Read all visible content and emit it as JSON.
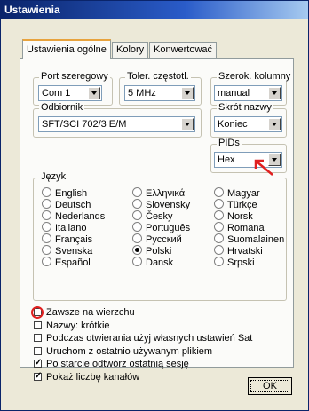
{
  "window": {
    "title": "Ustawienia"
  },
  "tabs": [
    {
      "label": "Ustawienia ogólne",
      "active": true
    },
    {
      "label": "Kolory",
      "active": false
    },
    {
      "label": "Konwertować",
      "active": false
    }
  ],
  "port": {
    "label": "Port szeregowy",
    "value": "Com 1"
  },
  "toler": {
    "label": "Toler. częstotl.",
    "value": "5 MHz"
  },
  "szerok": {
    "label": "Szerok. kolumny",
    "value": "manual"
  },
  "odbiornik": {
    "label": "Odbiornik",
    "value": "SFT/SCI 702/3 E/M"
  },
  "skrot": {
    "label": "Skrót nazwy",
    "value": "Koniec"
  },
  "pids": {
    "label": "PIDs",
    "value": "Hex"
  },
  "jezyk": {
    "label": "Język",
    "options": [
      {
        "label": "English",
        "selected": false
      },
      {
        "label": "Ελληνικά",
        "selected": false
      },
      {
        "label": "Magyar",
        "selected": false
      },
      {
        "label": "Deutsch",
        "selected": false
      },
      {
        "label": "Slovensky",
        "selected": false
      },
      {
        "label": "Türkçe",
        "selected": false
      },
      {
        "label": "Nederlands",
        "selected": false
      },
      {
        "label": "Česky",
        "selected": false
      },
      {
        "label": "Norsk",
        "selected": false
      },
      {
        "label": "Italiano",
        "selected": false
      },
      {
        "label": "Português",
        "selected": false
      },
      {
        "label": "Romana",
        "selected": false
      },
      {
        "label": "Français",
        "selected": false
      },
      {
        "label": "Русский",
        "selected": false
      },
      {
        "label": "Suomalainen",
        "selected": false
      },
      {
        "label": "Svenska",
        "selected": false
      },
      {
        "label": "Polski",
        "selected": true
      },
      {
        "label": "Hrvatski",
        "selected": false
      },
      {
        "label": "Español",
        "selected": false
      },
      {
        "label": "Dansk",
        "selected": false
      },
      {
        "label": "Srpski",
        "selected": false
      }
    ]
  },
  "checkboxes": [
    {
      "label": "Zawsze na wierzchu",
      "checked": false
    },
    {
      "label": "Nazwy: krótkie",
      "checked": false
    },
    {
      "label": "Podczas otwierania użyj własnych ustawień Sat",
      "checked": false
    },
    {
      "label": "Uruchom z ostatnio używanym plikiem",
      "checked": false
    },
    {
      "label": "Po starcie odtwórz ostatnią sesję",
      "checked": true
    },
    {
      "label": "Pokaż liczbę kanałów",
      "checked": true
    }
  ],
  "ok_button": {
    "label": "OK"
  },
  "annotation_color": "#e02020"
}
